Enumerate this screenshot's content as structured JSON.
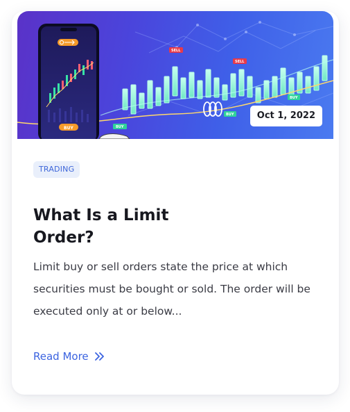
{
  "card": {
    "image": {
      "phone": {
        "button_label": "BUY"
      },
      "chart_tags": [
        "SELL",
        "SELL",
        "BUY",
        "BUY",
        "BUY"
      ]
    },
    "date": "Oct 1, 2022",
    "category": "TRADING",
    "title": "What Is a Limit Order?",
    "excerpt": "Limit buy or sell orders state the price at which securities must be bought or sold. The order will be executed only at or below...",
    "read_more": {
      "label": "Read More",
      "icon": "double-chevron-right-icon"
    }
  },
  "colors": {
    "accent": "#3b63e0",
    "tag_background": "#e9effb",
    "title": "#17181f",
    "body_text": "#3a3b44",
    "candle": "#8ff0c8",
    "sell_tag": "#e83a4a",
    "buy_tag": "#2fd39a",
    "phone_buy": "#f59a2a"
  }
}
